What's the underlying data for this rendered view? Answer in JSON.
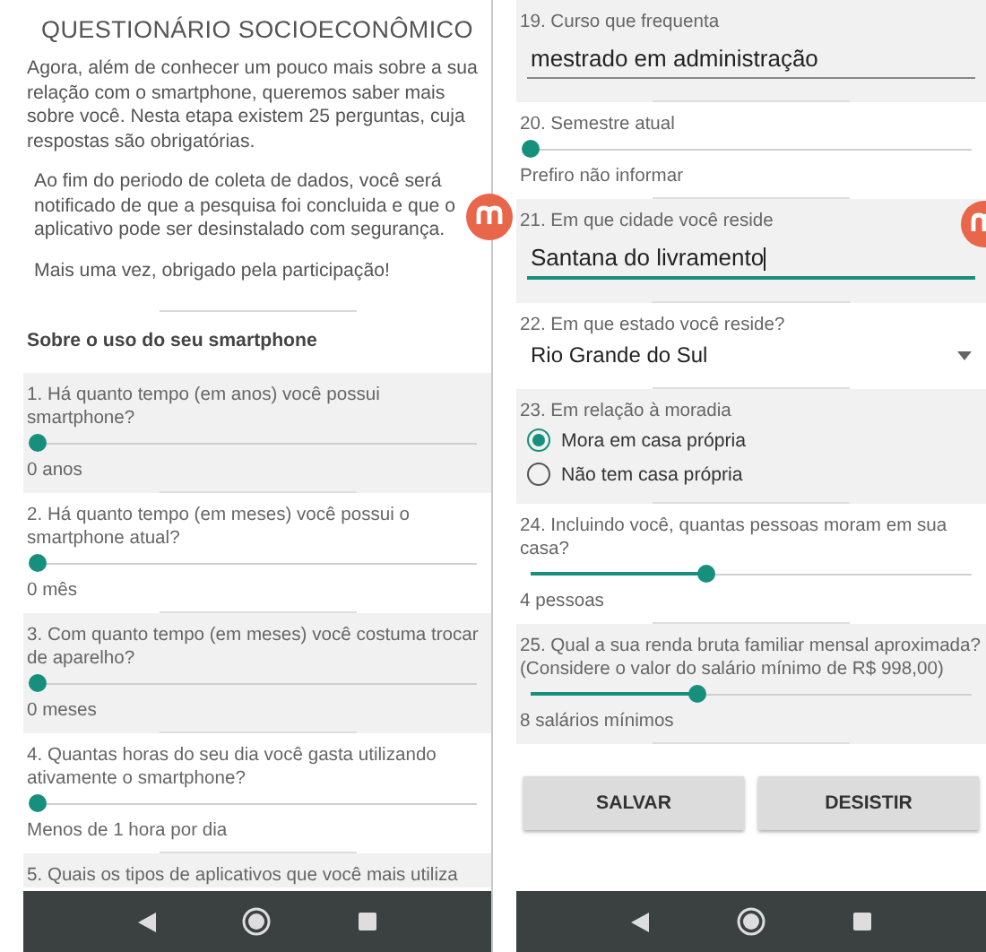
{
  "left_screen": {
    "title": "QUESTIONÁRIO SOCIOECONÔMICO",
    "paragraphs": [
      "Agora, além de conhecer um pouco mais sobre a sua relação com o smartphone, queremos saber mais sobre você. Nesta etapa existem 25 perguntas, cuja respostas são obrigatórias.",
      "Ao fim do periodo de coleta de dados, você será notificado de que a pesquisa foi concluida e que o aplicativo pode ser desinstalado com segurança.",
      "Mais uma vez, obrigado pela participação!"
    ],
    "section_heading": "Sobre o uso do seu smartphone",
    "questions": [
      {
        "kind": "slider",
        "label": "1. Há quanto tempo (em anos) você possui smartphone?",
        "level": 0,
        "reading": "0 anos"
      },
      {
        "kind": "slider",
        "label": "2. Há quanto tempo (em meses) você possui o smartphone atual?",
        "level": 0,
        "reading": "0 mês"
      },
      {
        "kind": "slider",
        "label": "3. Com quanto tempo (em meses) você costuma trocar de aparelho?",
        "level": 0,
        "reading": "0 meses"
      },
      {
        "kind": "slider",
        "label": "4. Quantas horas do seu dia você gasta utilizando ativamente o smartphone?",
        "level": 0,
        "reading": "Menos de 1 hora por dia"
      },
      {
        "kind": "heading_only",
        "label": "5. Quais os tipos de aplicativos que você mais utiliza"
      }
    ]
  },
  "right_screen": {
    "questions": [
      {
        "kind": "text",
        "label": "19. Curso que frequenta",
        "value": "mestrado em administração",
        "focused": false
      },
      {
        "kind": "slider",
        "label": "20. Semestre atual",
        "level": 0,
        "reading": "Prefiro não informar"
      },
      {
        "kind": "text",
        "label": "21. Em que cidade você reside",
        "value": "Santana do livramento",
        "focused": true
      },
      {
        "kind": "dropdown",
        "label": "22. Em que estado você reside?",
        "value": "Rio Grande do Sul"
      },
      {
        "kind": "radio",
        "label": "23. Em relação à moradia",
        "options": [
          {
            "label": "Mora em casa própria",
            "selected": true
          },
          {
            "label": "Não tem casa própria",
            "selected": false
          }
        ]
      },
      {
        "kind": "slider",
        "label": "24. Incluindo você, quantas pessoas moram em sua casa?",
        "level": 0.4,
        "reading": "4 pessoas"
      },
      {
        "kind": "slider",
        "label": "25. Qual a sua renda bruta familiar mensal aproximada? (Considere o valor do salário mínimo de R$ 998,00)",
        "level": 0.38,
        "reading": "8 salários mínimos"
      }
    ],
    "buttons": [
      "SALVAR",
      "DESISTIR"
    ]
  }
}
